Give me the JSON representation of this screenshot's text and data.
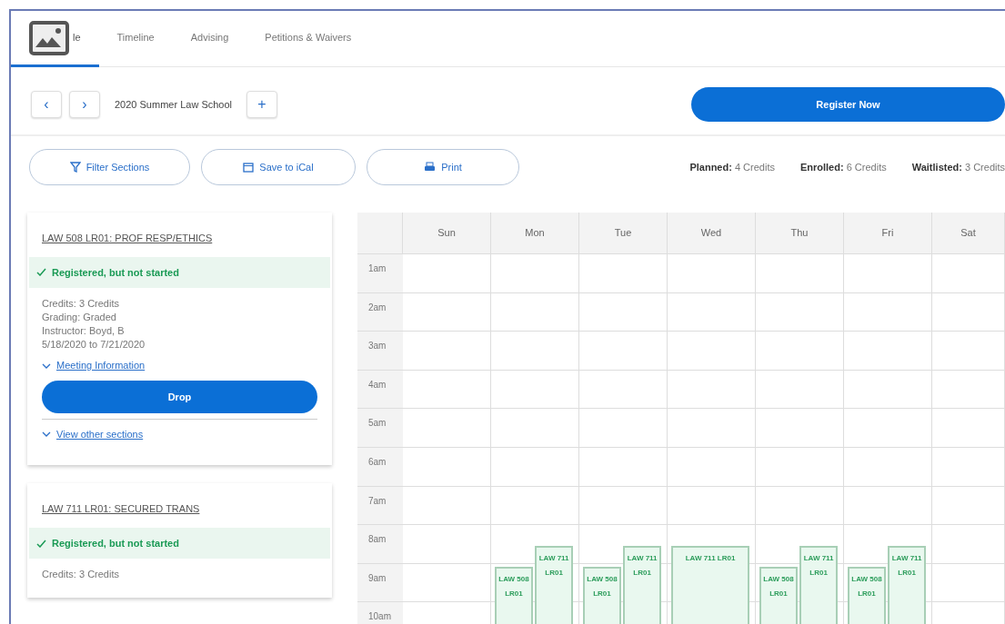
{
  "tabs": [
    {
      "label": "le",
      "selected": true,
      "covered": true
    },
    {
      "label": "Timeline",
      "selected": false,
      "covered": false
    },
    {
      "label": "Advising",
      "selected": false,
      "covered": false
    },
    {
      "label": "Petitions & Waivers",
      "selected": false,
      "covered": false
    }
  ],
  "term": {
    "prev": "‹",
    "next": "›",
    "title": "2020 Summer Law School",
    "add": "+",
    "register": "Register Now"
  },
  "actions": [
    {
      "label": "Filter Sections",
      "kind": "filter"
    },
    {
      "label": "Save to iCal",
      "kind": "calendar"
    },
    {
      "label": "Print",
      "kind": "print"
    }
  ],
  "credits": [
    {
      "label": "Planned:",
      "value": "4 Credits"
    },
    {
      "label": "Enrolled:",
      "value": "6 Credits"
    },
    {
      "label": "Waitlisted:",
      "value": "3 Credits"
    }
  ],
  "courses": [
    {
      "title": "LAW 508 LR01: PROF RESP/ETHICS",
      "status": "Registered, but not started",
      "details": [
        "Credits: 3 Credits",
        "Grading: Graded",
        "Instructor: Boyd, B",
        "5/18/2020 to 7/21/2020"
      ],
      "meeting": "Meeting Information",
      "drop": "Drop",
      "other": "View other sections"
    },
    {
      "title": "LAW 711 LR01: SECURED TRANS",
      "status": "Registered, but not started",
      "details": [
        "Credits: 3 Credits"
      ]
    }
  ],
  "calendar": {
    "days": [
      {
        "label": "Sun"
      },
      {
        "label": "Mon",
        "events": [
          {
            "label": "LAW 508 LR01",
            "kind": "left"
          },
          {
            "label": "LAW 711 LR01",
            "kind": "right"
          }
        ]
      },
      {
        "label": "Tue",
        "events": [
          {
            "label": "LAW 508 LR01",
            "kind": "left"
          },
          {
            "label": "LAW 711 LR01",
            "kind": "right"
          }
        ]
      },
      {
        "label": "Wed",
        "events": [
          {
            "label": "LAW 711 LR01",
            "kind": "full"
          }
        ]
      },
      {
        "label": "Thu",
        "events": [
          {
            "label": "LAW 508 LR01",
            "kind": "left"
          },
          {
            "label": "LAW 711 LR01",
            "kind": "right"
          }
        ]
      },
      {
        "label": "Fri",
        "events": [
          {
            "label": "LAW 508 LR01",
            "kind": "left"
          },
          {
            "label": "LAW 711 LR01",
            "kind": "right"
          }
        ]
      },
      {
        "label": "Sat"
      }
    ],
    "hours": [
      "1am",
      "2am",
      "3am",
      "4am",
      "5am",
      "6am",
      "7am",
      "8am",
      "9am",
      "10am"
    ]
  }
}
